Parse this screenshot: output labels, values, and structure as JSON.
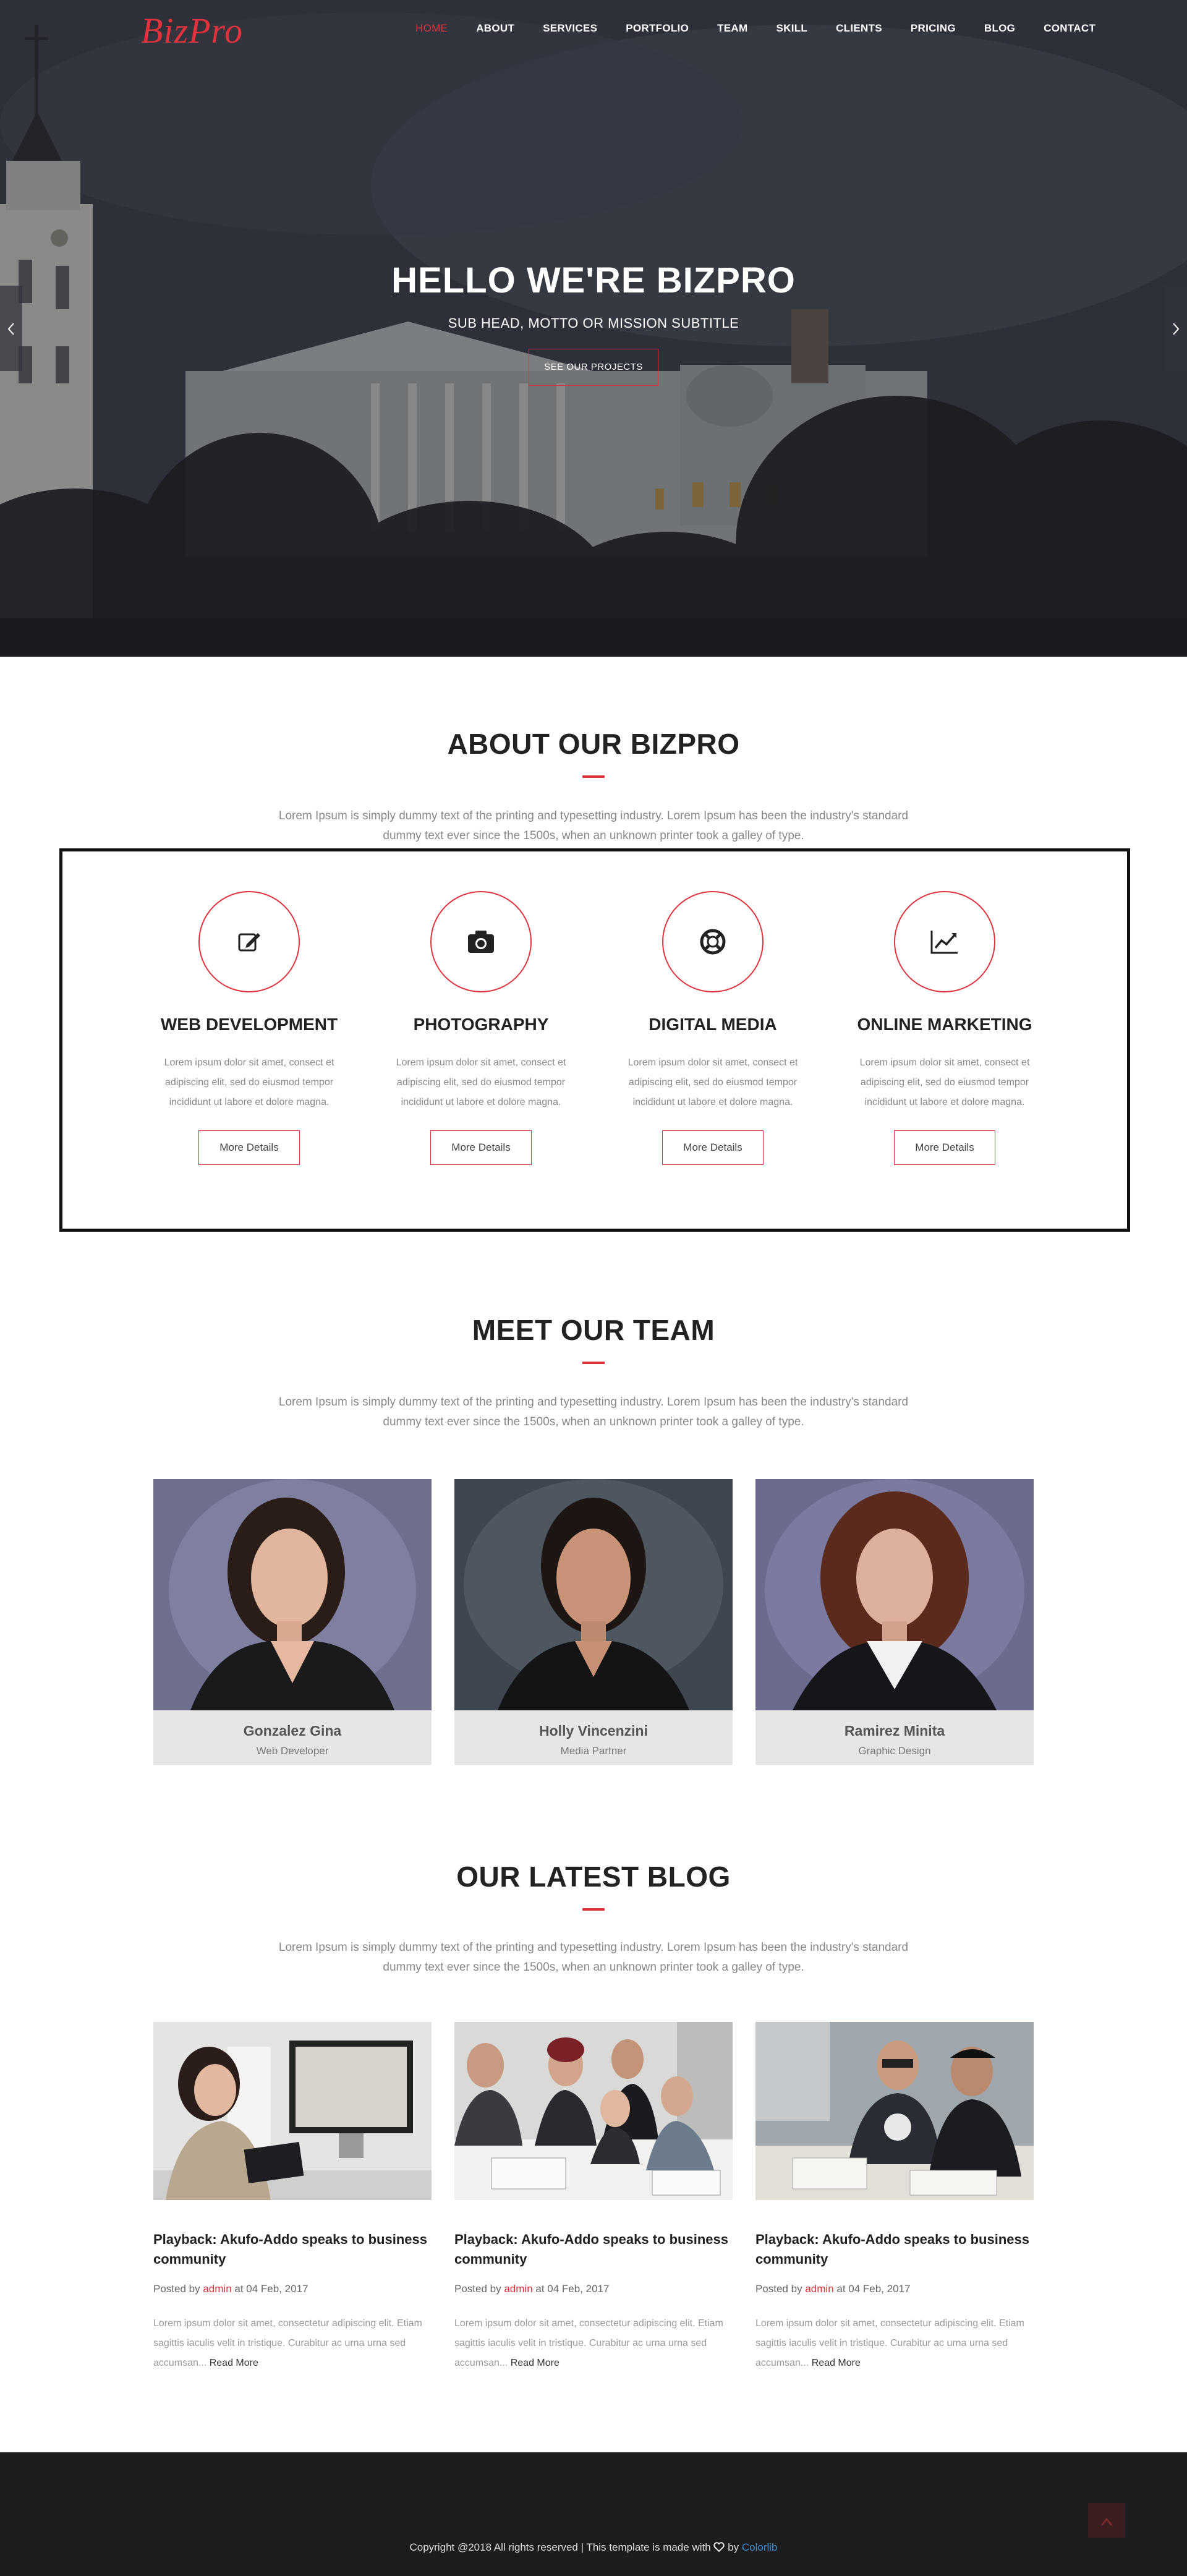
{
  "brand": {
    "logo": "BizPro",
    "accent": "#e0323c"
  },
  "nav": {
    "items": [
      "HOME",
      "ABOUT",
      "SERVICES",
      "PORTFOLIO",
      "TEAM",
      "SKILL",
      "CLIENTS",
      "PRICING",
      "BLOG",
      "CONTACT"
    ],
    "active": "HOME"
  },
  "hero": {
    "title": "HELLO WE'RE BIZPRO",
    "subtitle": "SUB HEAD, MOTTO OR MISSION SUBTITLE",
    "button": "SEE OUR PROJECTS",
    "prev_icon": "chevron-left-icon",
    "next_icon": "chevron-right-icon"
  },
  "about": {
    "title": "ABOUT OUR BIZPRO",
    "desc": "Lorem Ipsum is simply dummy text of the printing and typesetting industry. Lorem Ipsum has been the industry's standard dummy text ever since the 1500s, when an unknown printer took a galley of type.",
    "services": [
      {
        "icon": "edit-icon",
        "title": "WEB DEVELOPMENT",
        "text": "Lorem ipsum dolor sit amet, consect et adipiscing elit, sed do eiusmod tempor incididunt ut labore et dolore magna.",
        "button": "More Details"
      },
      {
        "icon": "camera-icon",
        "title": "PHOTOGRAPHY",
        "text": "Lorem ipsum dolor sit amet, consect et adipiscing elit, sed do eiusmod tempor incididunt ut labore et dolore magna.",
        "button": "More Details"
      },
      {
        "icon": "life-ring-icon",
        "title": "DIGITAL MEDIA",
        "text": "Lorem ipsum dolor sit amet, consect et adipiscing elit, sed do eiusmod tempor incididunt ut labore et dolore magna.",
        "button": "More Details"
      },
      {
        "icon": "line-chart-icon",
        "title": "ONLINE MARKETING",
        "text": "Lorem ipsum dolor sit amet, consect et adipiscing elit, sed do eiusmod tempor incididunt ut labore et dolore magna.",
        "button": "More Details"
      }
    ]
  },
  "team": {
    "title": "MEET OUR TEAM",
    "desc": "Lorem Ipsum is simply dummy text of the printing and typesetting industry. Lorem Ipsum has been the industry's standard dummy text ever since the 1500s, when an unknown printer took a galley of type.",
    "members": [
      {
        "name": "Gonzalez Gina",
        "role": "Web Developer"
      },
      {
        "name": "Holly Vincenzini",
        "role": "Media Partner"
      },
      {
        "name": "Ramirez Minita",
        "role": "Graphic Design"
      }
    ]
  },
  "blog": {
    "title": "OUR LATEST BLOG",
    "desc": "Lorem Ipsum is simply dummy text of the printing and typesetting industry. Lorem Ipsum has been the industry's standard dummy text ever since the 1500s, when an unknown printer took a galley of type.",
    "posts": [
      {
        "title": "Playback: Akufo-Addo speaks to business community",
        "posted_by": "Posted by",
        "author": "admin",
        "date": "at 04 Feb, 2017",
        "excerpt": "Lorem ipsum dolor sit amet, consectetur adipiscing elit. Etiam sagittis iaculis velit in tristique. Curabitur ac urna urna sed accumsan...",
        "read_more": "Read More"
      },
      {
        "title": "Playback: Akufo-Addo speaks to business community",
        "posted_by": "Posted by",
        "author": "admin",
        "date": "at 04 Feb, 2017",
        "excerpt": "Lorem ipsum dolor sit amet, consectetur adipiscing elit. Etiam sagittis iaculis velit in tristique. Curabitur ac urna urna sed accumsan...",
        "read_more": "Read More"
      },
      {
        "title": "Playback: Akufo-Addo speaks to business community",
        "posted_by": "Posted by",
        "author": "admin",
        "date": "at 04 Feb, 2017",
        "excerpt": "Lorem ipsum dolor sit amet, consectetur adipiscing elit. Etiam sagittis iaculis velit in tristique. Curabitur ac urna urna sed accumsan...",
        "read_more": "Read More"
      }
    ]
  },
  "footer": {
    "text_before": "Copyright @2018 All rights reserved | This template is made with",
    "heart_icon": "heart-icon",
    "by": "by",
    "link": "Colorlib",
    "to_top_icon": "arrow-up-icon"
  }
}
